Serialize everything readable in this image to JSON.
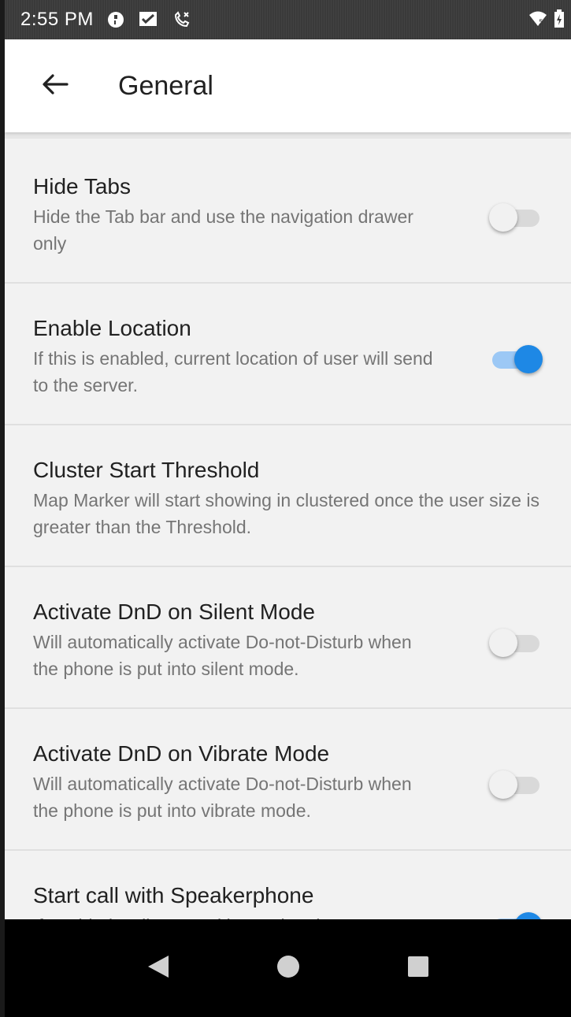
{
  "status_bar": {
    "time": "2:55 PM",
    "icons": [
      "data-saver-icon",
      "message-check-icon",
      "missed-call-icon"
    ],
    "right_icons": [
      "wifi-icon",
      "battery-icon"
    ]
  },
  "app_bar": {
    "back_icon": "arrow-left-icon",
    "title": "General"
  },
  "settings": [
    {
      "title": "Hide Tabs",
      "subtitle": "Hide the Tab bar and use the navigation drawer only",
      "toggle": false
    },
    {
      "title": "Enable Location",
      "subtitle": "If this is enabled, current location of user will send to the server.",
      "toggle": true
    },
    {
      "title": "Cluster Start Threshold",
      "subtitle": "Map Marker will start showing in clustered once the user size is greater than the Threshold."
    },
    {
      "title": "Activate DnD on Silent Mode",
      "subtitle": "Will automatically activate Do-not-Disturb when the phone is put into silent mode.",
      "toggle": false
    },
    {
      "title": "Activate DnD on Vibrate Mode",
      "subtitle": "Will automatically activate Do-not-Disturb when the phone is put into vibrate mode.",
      "toggle": false
    },
    {
      "title": "Start call with Speakerphone",
      "subtitle": "If enabled, calls start with speakerphone,",
      "toggle": true
    }
  ],
  "nav_bar": {
    "icons": [
      "back-triangle-icon",
      "home-circle-icon",
      "recents-square-icon"
    ]
  },
  "colors": {
    "accent": "#1e88e5",
    "accent_track": "#9cc8f5",
    "background": "#f2f2f2",
    "status_bar": "#3a3a3a"
  }
}
